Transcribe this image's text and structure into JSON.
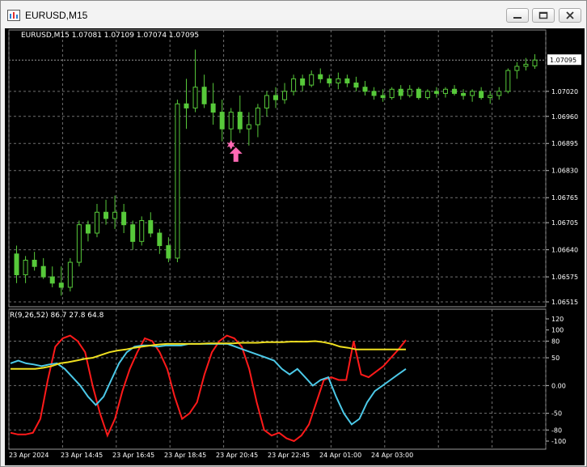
{
  "window": {
    "title": "EURUSD,M15",
    "controls": [
      "minimize",
      "maximize",
      "close"
    ]
  },
  "main_pane": {
    "header": "EURUSD,M15  1.07081 1.07109 1.07074 1.07095",
    "current_price_label": "1.07095",
    "price_ticks": [
      "1.07020",
      "1.06960",
      "1.06895",
      "1.06830",
      "1.06765",
      "1.06705",
      "1.06640",
      "1.06575",
      "1.06515"
    ]
  },
  "indicator_pane": {
    "header": "R(9,26,52) 86.7 27.8 64.8",
    "ticks": [
      "120",
      "100",
      "80",
      "50",
      "0.00",
      "-50",
      "-80",
      "-100"
    ]
  },
  "time_axis": {
    "labels": [
      "23 Apr 2024",
      "23 Apr 14:45",
      "23 Apr 16:45",
      "23 Apr 18:45",
      "23 Apr 20:45",
      "23 Apr 22:45",
      "24 Apr 01:00",
      "24 Apr 03:00"
    ]
  },
  "colors": {
    "background": "#000000",
    "candles": "#57c93a",
    "grid": "#707070",
    "osc_fast": "#ff1a1a",
    "osc_mid": "#4cc9e8",
    "osc_slow": "#f0e020",
    "signal_marker": "#ff69b4"
  },
  "chart_data": [
    {
      "type": "candlestick",
      "title": "EURUSD,M15",
      "ohlc_last": {
        "open": 1.07081,
        "high": 1.07109,
        "low": 1.07074,
        "close": 1.07095
      },
      "ylim": [
        1.06515,
        1.07109
      ],
      "candles": [
        [
          1.0663,
          1.0665,
          1.0656,
          1.0658
        ],
        [
          1.0658,
          1.06625,
          1.0656,
          1.06615
        ],
        [
          1.06615,
          1.06635,
          1.0659,
          1.066
        ],
        [
          1.066,
          1.0662,
          1.0657,
          1.06575
        ],
        [
          1.06575,
          1.066,
          1.0655,
          1.0656
        ],
        [
          1.0656,
          1.066,
          1.0653,
          1.0655
        ],
        [
          1.0655,
          1.0662,
          1.0654,
          1.0661
        ],
        [
          1.0661,
          1.0671,
          1.066,
          1.067
        ],
        [
          1.067,
          1.0671,
          1.0666,
          1.0668
        ],
        [
          1.0668,
          1.0675,
          1.0667,
          1.0673
        ],
        [
          1.0673,
          1.0676,
          1.067,
          1.06715
        ],
        [
          1.06715,
          1.0677,
          1.0669,
          1.0673
        ],
        [
          1.0673,
          1.0675,
          1.0668,
          1.067
        ],
        [
          1.067,
          1.0671,
          1.0664,
          1.0666
        ],
        [
          1.0666,
          1.0672,
          1.0665,
          1.0671
        ],
        [
          1.0671,
          1.0673,
          1.0667,
          1.0668
        ],
        [
          1.0668,
          1.0669,
          1.0663,
          1.0665
        ],
        [
          1.0665,
          1.0667,
          1.0661,
          1.0662
        ],
        [
          1.0662,
          1.07,
          1.0661,
          1.0699
        ],
        [
          1.0699,
          1.0705,
          1.0693,
          1.0698
        ],
        [
          1.0698,
          1.0712,
          1.0697,
          1.0703
        ],
        [
          1.0703,
          1.0706,
          1.0698,
          1.0699
        ],
        [
          1.0699,
          1.0704,
          1.0694,
          1.0697
        ],
        [
          1.0697,
          1.07,
          1.069,
          1.0693
        ],
        [
          1.0693,
          1.0698,
          1.069,
          1.0697
        ],
        [
          1.0697,
          1.0701,
          1.0692,
          1.0693
        ],
        [
          1.0693,
          1.0697,
          1.0689,
          1.0694
        ],
        [
          1.0694,
          1.0699,
          1.0691,
          1.0698
        ],
        [
          1.0698,
          1.0702,
          1.0696,
          1.0701
        ],
        [
          1.0701,
          1.0703,
          1.0698,
          1.07
        ],
        [
          1.07,
          1.0704,
          1.0699,
          1.0702
        ],
        [
          1.0702,
          1.0706,
          1.0701,
          1.0705
        ],
        [
          1.0705,
          1.0706,
          1.0702,
          1.07035
        ],
        [
          1.07035,
          1.0707,
          1.0703,
          1.0706
        ],
        [
          1.0706,
          1.07075,
          1.0704,
          1.0705
        ],
        [
          1.0705,
          1.0706,
          1.0703,
          1.0704
        ],
        [
          1.0704,
          1.07065,
          1.07025,
          1.0705
        ],
        [
          1.0705,
          1.0706,
          1.0703,
          1.0704
        ],
        [
          1.0704,
          1.07055,
          1.0702,
          1.0703
        ],
        [
          1.0703,
          1.07045,
          1.0701,
          1.0702
        ],
        [
          1.0702,
          1.0703,
          1.07,
          1.0701
        ],
        [
          1.0701,
          1.07025,
          1.06995,
          1.07005
        ],
        [
          1.07005,
          1.0703,
          1.07,
          1.07025
        ],
        [
          1.07025,
          1.07035,
          1.07,
          1.0701
        ],
        [
          1.0701,
          1.07035,
          1.07005,
          1.07025
        ],
        [
          1.07025,
          1.0703,
          1.07,
          1.07005
        ],
        [
          1.07005,
          1.07025,
          1.07,
          1.0702
        ],
        [
          1.0702,
          1.0703,
          1.07005,
          1.07015
        ],
        [
          1.07015,
          1.0703,
          1.07005,
          1.07025
        ],
        [
          1.07025,
          1.07035,
          1.0701,
          1.07015
        ],
        [
          1.07015,
          1.07025,
          1.07,
          1.0701
        ],
        [
          1.0701,
          1.07025,
          1.06995,
          1.0702
        ],
        [
          1.0702,
          1.0703,
          1.07,
          1.07005
        ],
        [
          1.07005,
          1.0702,
          1.0699,
          1.0701
        ],
        [
          1.0701,
          1.0703,
          1.07,
          1.0702
        ],
        [
          1.0702,
          1.07075,
          1.07015,
          1.0707
        ],
        [
          1.0707,
          1.0709,
          1.0705,
          1.0708
        ],
        [
          1.0708,
          1.071,
          1.0707,
          1.07085
        ],
        [
          1.07081,
          1.07109,
          1.07074,
          1.07095
        ]
      ],
      "current_price": 1.07095,
      "signal": {
        "type": "buy-arrow",
        "candle_index": 24,
        "price": 1.0689
      }
    },
    {
      "type": "line",
      "title": "R(9,26,52)",
      "ylim": [
        -100,
        120
      ],
      "series": [
        {
          "name": "",
          "color": "#ff1a1a",
          "values": [
            -85,
            -88,
            -88,
            -85,
            -60,
            10,
            70,
            85,
            90,
            80,
            60,
            0,
            -50,
            -90,
            -60,
            -10,
            30,
            60,
            85,
            80,
            60,
            30,
            -20,
            -60,
            -50,
            -30,
            20,
            60,
            80,
            90,
            85,
            70,
            30,
            -30,
            -80,
            -90,
            -85,
            -95,
            -100,
            -90,
            -70,
            -30,
            10,
            15,
            10,
            10,
            80,
            20,
            15,
            25,
            35,
            50,
            65,
            82
          ]
        },
        {
          "name": "",
          "color": "#4cc9e8",
          "values": [
            40,
            45,
            40,
            38,
            35,
            38,
            40,
            30,
            15,
            0,
            -20,
            -35,
            -20,
            10,
            40,
            60,
            70,
            72,
            72,
            70,
            72,
            72,
            72,
            75,
            75,
            75,
            75,
            75,
            75,
            70,
            65,
            60,
            55,
            50,
            45,
            30,
            20,
            30,
            15,
            0,
            10,
            15,
            -20,
            -50,
            -70,
            -60,
            -30,
            -10,
            0,
            10,
            20,
            30
          ]
        },
        {
          "name": "",
          "color": "#f0e020",
          "values": [
            30,
            30,
            30,
            30,
            32,
            35,
            40,
            42,
            45,
            48,
            50,
            55,
            60,
            63,
            65,
            68,
            70,
            72,
            74,
            75,
            75,
            75,
            75,
            75,
            76,
            76,
            76,
            76,
            77,
            77,
            77,
            78,
            78,
            78,
            79,
            79,
            79,
            80,
            78,
            75,
            70,
            68,
            65,
            65,
            65,
            65,
            65,
            65,
            65
          ]
        }
      ]
    }
  ]
}
